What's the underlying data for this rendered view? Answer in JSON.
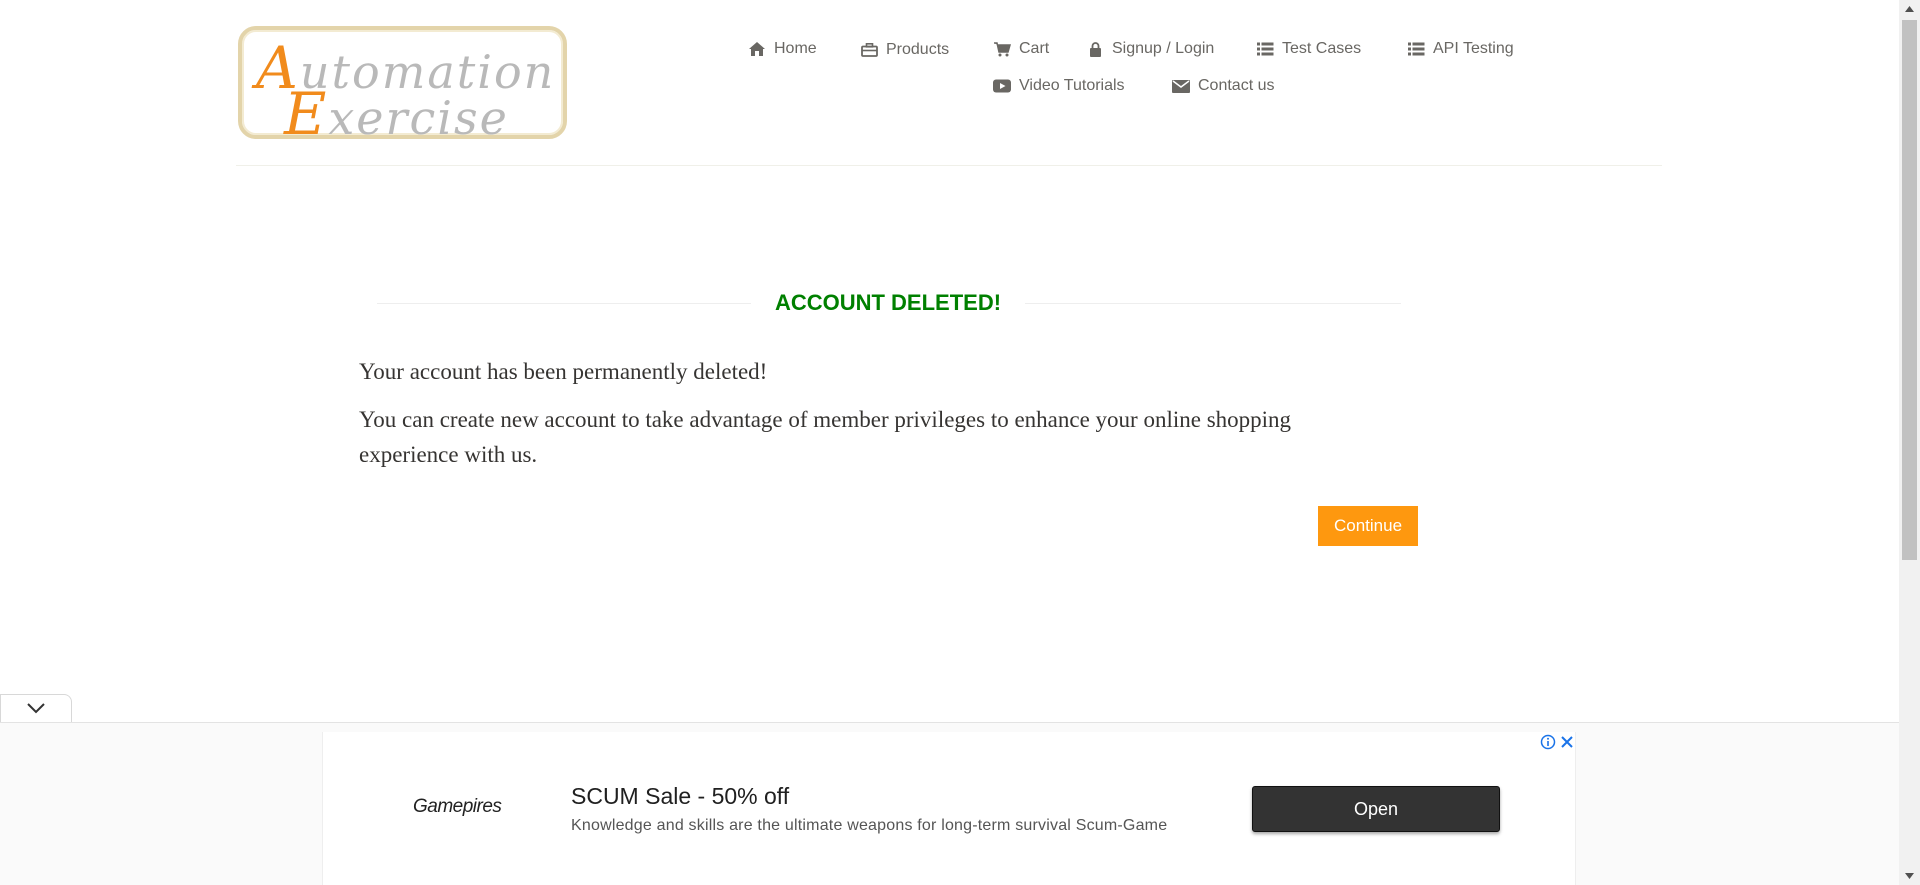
{
  "logo": {
    "line1_cap": "A",
    "line1_rest": "utomation",
    "line2_cap": "E",
    "line2_rest": "xercise",
    "colors": {
      "accent": "#f18b1c",
      "text": "#b9b9b9",
      "border": "#e3d4aa"
    }
  },
  "nav": {
    "home": {
      "label": "Home",
      "icon": "home-icon"
    },
    "products": {
      "label": "Products",
      "icon": "briefcase-icon"
    },
    "cart": {
      "label": "Cart",
      "icon": "shopping-cart-icon"
    },
    "signup": {
      "label": "Signup / Login",
      "icon": "lock-icon"
    },
    "test_cases": {
      "label": "Test Cases",
      "icon": "list-icon"
    },
    "api_testing": {
      "label": "API Testing",
      "icon": "list-icon"
    },
    "video_tutorials": {
      "label": "Video Tutorials",
      "icon": "youtube-play-icon"
    },
    "contact": {
      "label": "Contact us",
      "icon": "envelope-icon"
    }
  },
  "content": {
    "title": "ACCOUNT DELETED!",
    "message1": "Your account has been permanently deleted!",
    "message2": "You can create new account to take advantage of member privileges to enhance your online shopping experience with us.",
    "continue_label": "Continue",
    "colors": {
      "title": "#008000",
      "button": "#fe980f"
    }
  },
  "ad": {
    "brand": "Gamepires",
    "title": "SCUM Sale - 50% off",
    "description": "Knowledge and skills are the ultimate weapons for long-term survival Scum-Game",
    "open_label": "Open"
  }
}
